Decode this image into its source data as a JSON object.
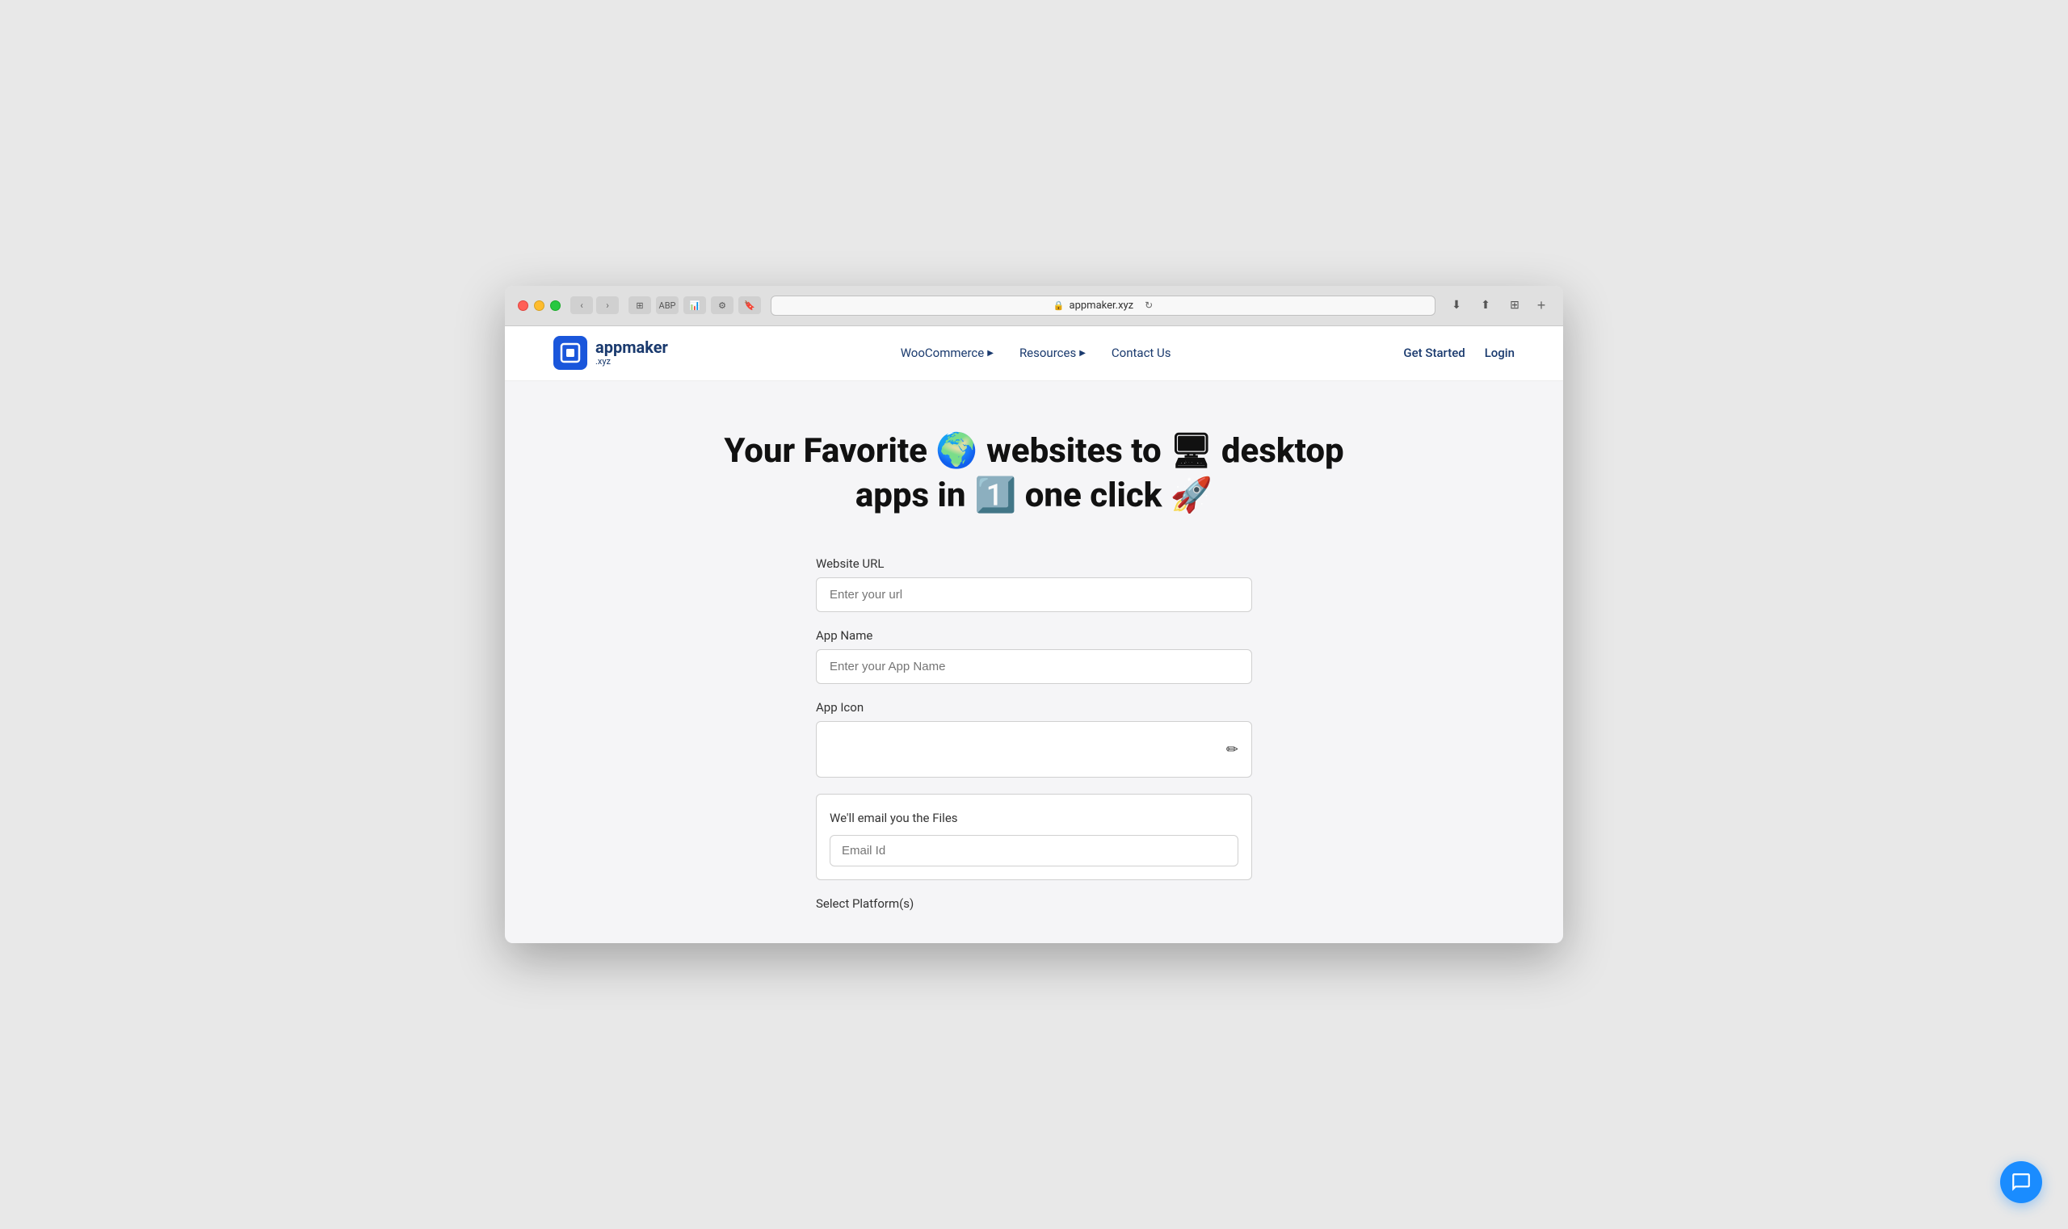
{
  "browser": {
    "url": "appmaker.xyz",
    "lock_icon": "🔒",
    "refresh_icon": "↻",
    "new_tab": "+"
  },
  "nav": {
    "logo_text": "appmaker",
    "logo_subtext": ".xyz",
    "logo_icon": "□",
    "woocommerce_label": "WooCommerce",
    "resources_label": "Resources",
    "contact_label": "Contact Us",
    "get_started_label": "Get Started",
    "login_label": "Login"
  },
  "hero": {
    "title": "Your Favorite 🌍 websites to 🖥 desktop apps in 1️⃣ one click 🚀"
  },
  "form": {
    "website_url_label": "Website URL",
    "website_url_placeholder": "Enter your url",
    "app_name_label": "App Name",
    "app_name_placeholder": "Enter your App Name",
    "app_icon_label": "App Icon",
    "email_section_title": "We'll email you the Files",
    "email_placeholder": "Email Id",
    "platform_label": "Select Platform(s)"
  },
  "chat": {
    "title": "Chat support"
  }
}
